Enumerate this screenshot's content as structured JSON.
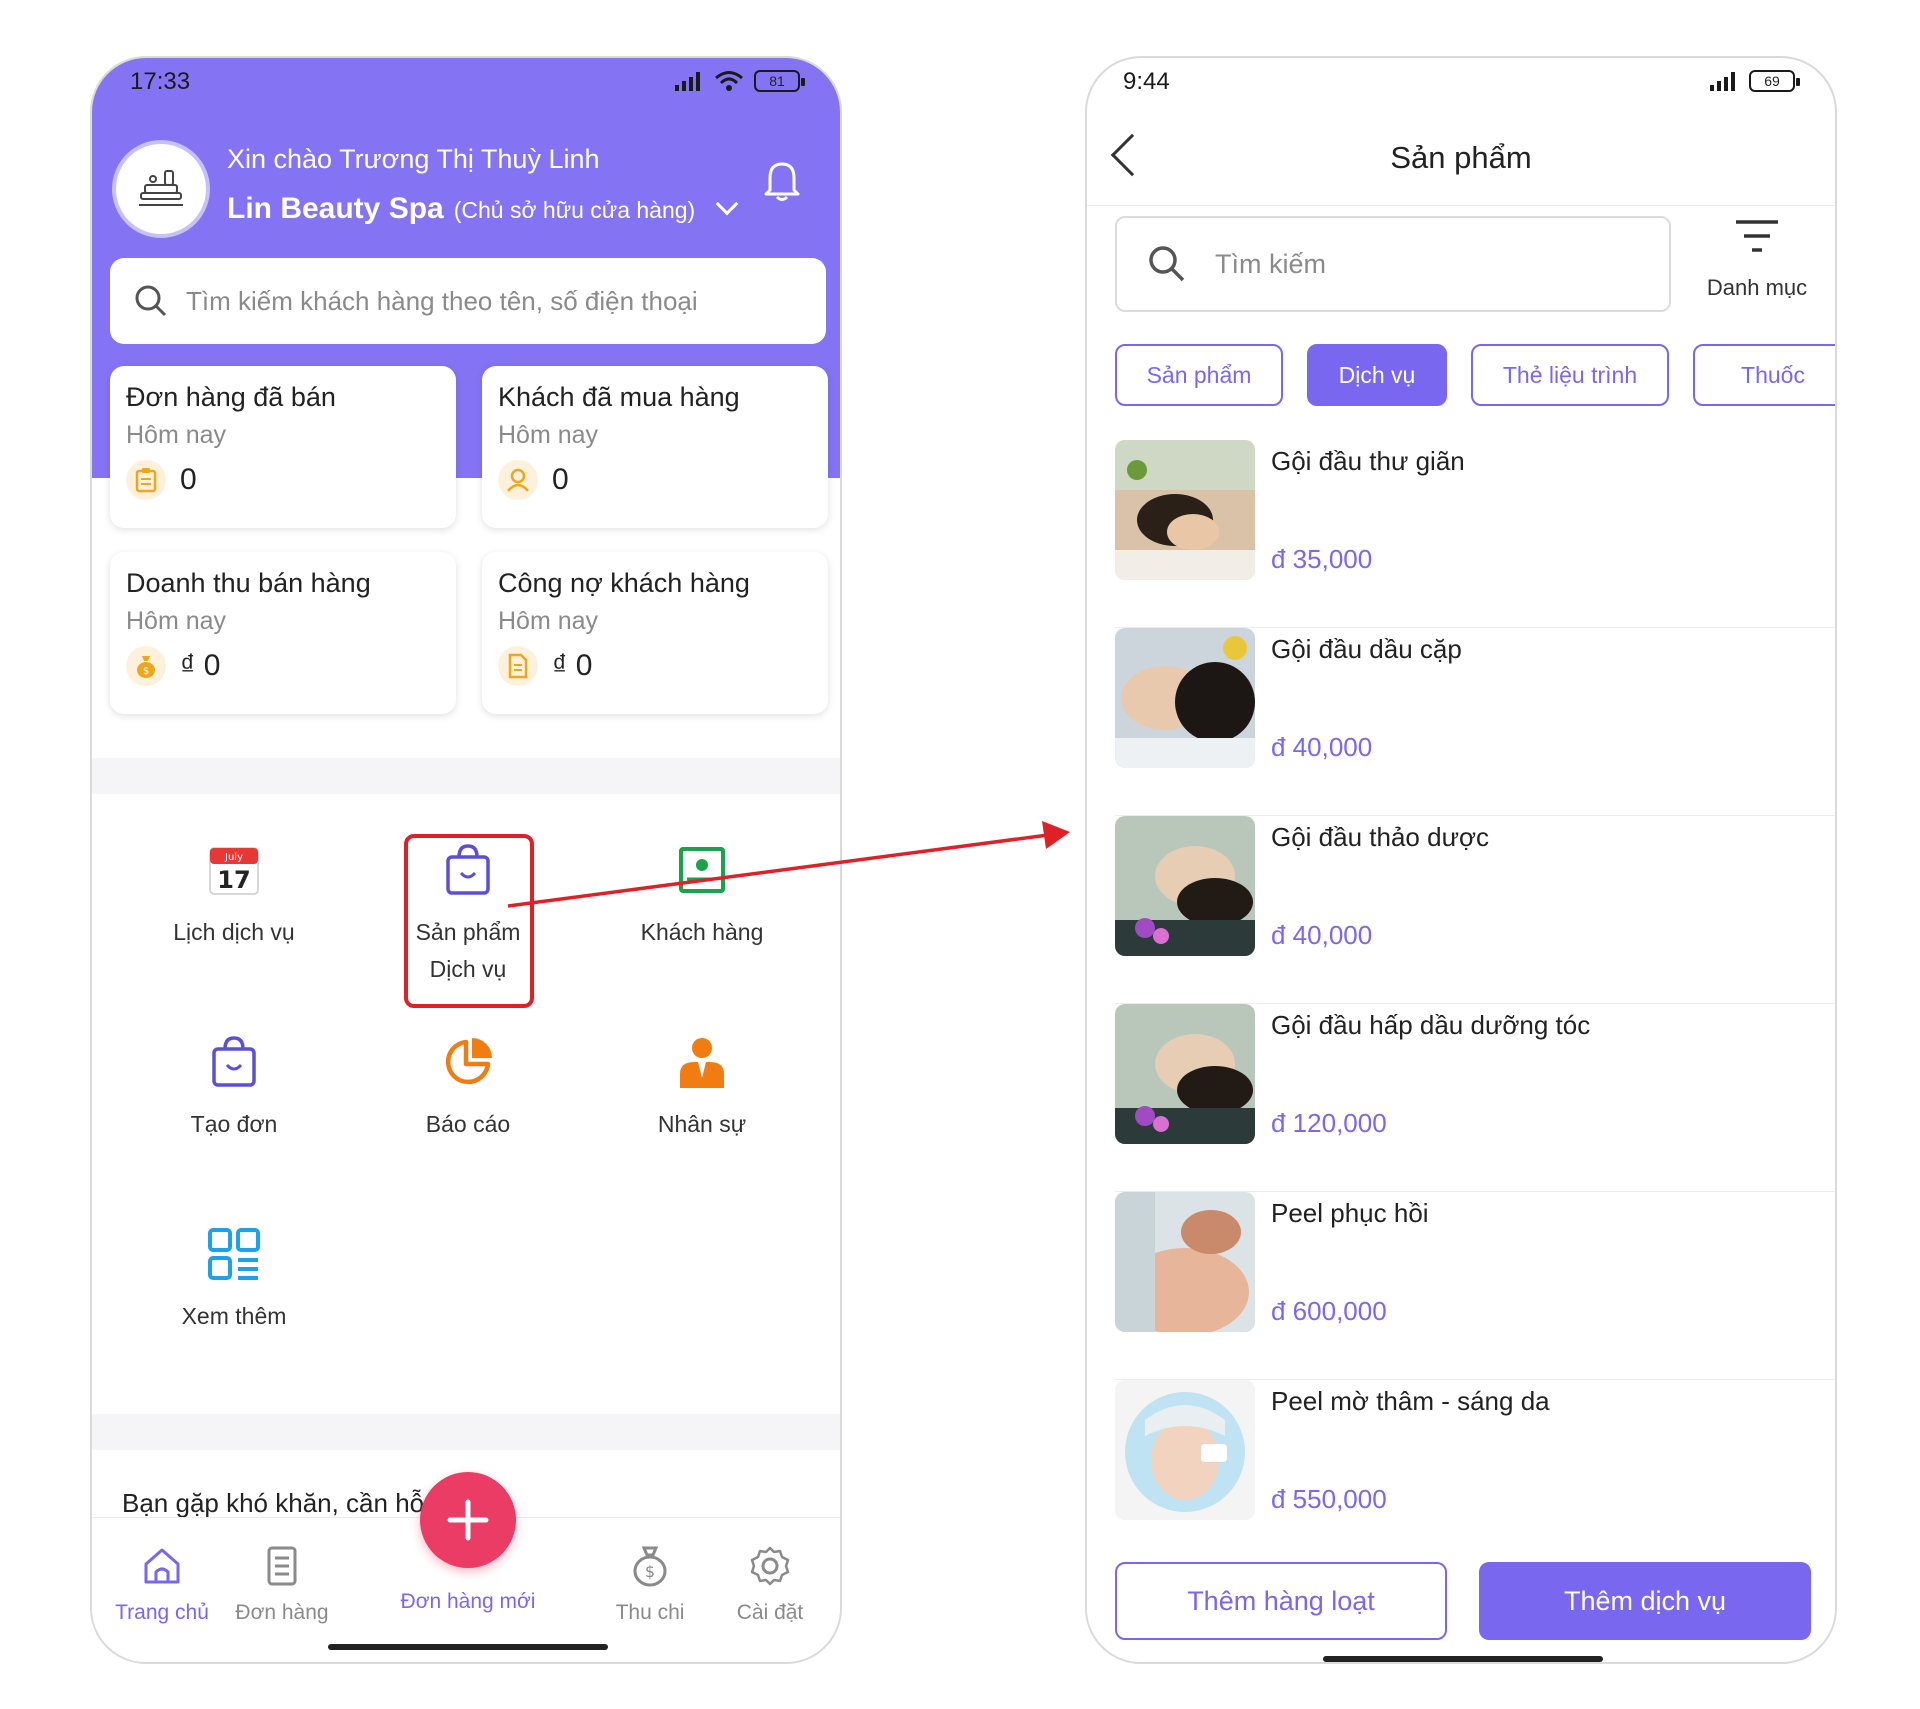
{
  "left": {
    "status": {
      "time": "17:33",
      "battery": "81"
    },
    "header": {
      "greeting": "Xin chào Trương Thị Thuỳ Linh",
      "shop_name": "Lin Beauty Spa",
      "shop_role": "(Chủ sở hữu cửa hàng)"
    },
    "search": {
      "placeholder": "Tìm kiếm khách hàng theo tên, số điện thoại"
    },
    "stats": [
      {
        "title": "Đơn hàng đã bán",
        "period": "Hôm nay",
        "value": "0",
        "icon": "clipboard-icon"
      },
      {
        "title": "Khách đã mua hàng",
        "period": "Hôm nay",
        "value": "0",
        "icon": "user-icon"
      },
      {
        "title": "Doanh thu bán hàng",
        "period": "Hôm nay",
        "value": "₫ 0",
        "icon": "money-bag-icon"
      },
      {
        "title": "Công nợ khách hàng",
        "period": "Hôm nay",
        "value": "₫ 0",
        "icon": "document-icon"
      }
    ],
    "menu": [
      {
        "label": "Lịch dịch vụ",
        "icon": "calendar-icon",
        "calendar_month": "July",
        "calendar_day": "17"
      },
      {
        "label": "Sản phẩm Dịch vụ",
        "icon": "shopping-bag-icon"
      },
      {
        "label": "Khách hàng",
        "icon": "customer-card-icon"
      },
      {
        "label": "Tạo đơn",
        "icon": "shopping-bag-icon"
      },
      {
        "label": "Báo cáo",
        "icon": "pie-chart-icon"
      },
      {
        "label": "Nhân sự",
        "icon": "staff-icon"
      },
      {
        "label": "Xem thêm",
        "icon": "grid-icon"
      }
    ],
    "support_title": "Bạn gặp khó khăn, cần hỗ trợ?",
    "tabbar": [
      {
        "label": "Trang chủ",
        "icon": "home-icon",
        "active": true
      },
      {
        "label": "Đơn hàng",
        "icon": "order-list-icon"
      },
      {
        "label": "Đơn hàng mới",
        "icon": "plus-icon"
      },
      {
        "label": "Thu chi",
        "icon": "money-bag-icon"
      },
      {
        "label": "Cài đặt",
        "icon": "gear-icon"
      }
    ]
  },
  "right": {
    "status": {
      "time": "9:44",
      "battery": "69"
    },
    "title": "Sản phẩm",
    "search": {
      "placeholder": "Tìm kiếm"
    },
    "filter_label": "Danh mục",
    "chips": [
      {
        "label": "Sản phẩm",
        "active": false
      },
      {
        "label": "Dịch vụ",
        "active": true
      },
      {
        "label": "Thẻ liệu trình",
        "active": false
      },
      {
        "label": "Thuốc",
        "active": false
      }
    ],
    "products": [
      {
        "name": "Gội đầu thư giãn",
        "price": "đ 35,000"
      },
      {
        "name": "Gội đầu dầu cặp",
        "price": "đ 40,000"
      },
      {
        "name": "Gội đầu thảo dược",
        "price": "đ 40,000"
      },
      {
        "name": "Gội đầu hấp dầu dưỡng tóc",
        "price": "đ 120,000"
      },
      {
        "name": "Peel phục hồi",
        "price": "đ 600,000"
      },
      {
        "name": "Peel mờ thâm - sáng da",
        "price": "đ 550,000"
      }
    ],
    "buttons": {
      "bulk_add": "Thêm hàng loạt",
      "add_service": "Thêm dịch vụ"
    }
  },
  "colors": {
    "primary": "#7a67ef",
    "hero": "#8474f4",
    "fab": "#ea3c64",
    "highlight": "#e11f26"
  }
}
